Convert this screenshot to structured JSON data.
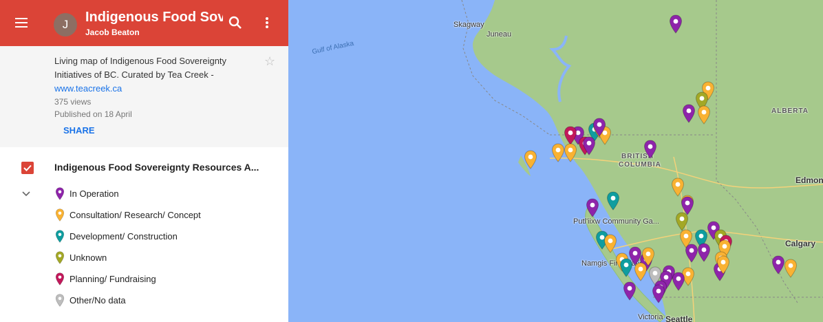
{
  "header": {
    "avatar_letter": "J",
    "title": "Indigenous Food Sove...",
    "author": "Jacob Beaton",
    "color": "#db4437"
  },
  "info": {
    "description": "Living map of Indigenous Food Sovereignty Initiatives of BC. Curated by Tea Creek -",
    "link": "www.teacreek.ca",
    "views": "375 views",
    "published": "Published on 18 April",
    "share_label": "SHARE"
  },
  "layer": {
    "title": "Indigenous Food Sovereignty Resources A...",
    "legend": [
      {
        "label": "In Operation",
        "color": "#8e24aa"
      },
      {
        "label": "Consultation/ Research/ Concept",
        "color": "#f9b233"
      },
      {
        "label": "Development/ Construction",
        "color": "#0f9d9f"
      },
      {
        "label": "Unknown",
        "color": "#a3a826"
      },
      {
        "label": "Planning/ Fundraising",
        "color": "#c2185b"
      },
      {
        "label": "Other/No data",
        "color": "#bdbdbd"
      }
    ]
  },
  "map": {
    "places": {
      "skagway": "Skagway",
      "juneau": "Juneau",
      "gulf": "Gulf of Alaska",
      "bc1": "BRITISH",
      "bc2": "COLUMBIA",
      "alberta": "ALBERTA",
      "edmonton": "Edmont",
      "calgary": "Calgary",
      "putl": "Putl'iixw Community Ga...",
      "namgis": "Namgis First Nation",
      "victoria": "Victoria",
      "seattle": "Seattle"
    }
  }
}
